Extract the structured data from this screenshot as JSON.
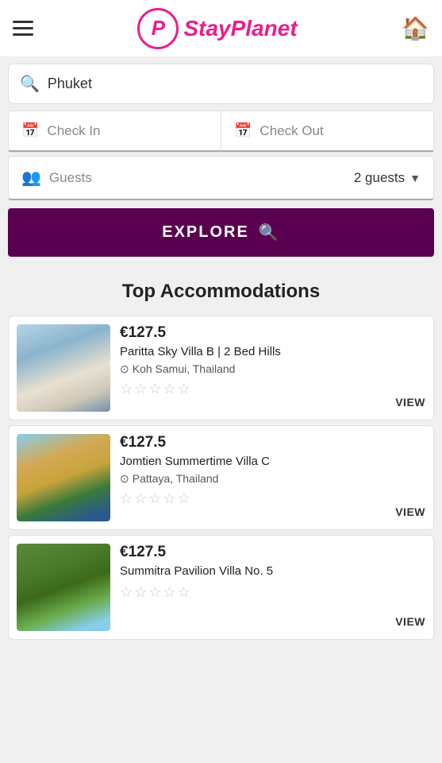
{
  "header": {
    "logo_letter": "P",
    "logo_name": "StayPlanet",
    "home_icon": "🏠"
  },
  "search": {
    "placeholder": "Phuket",
    "value": "Phuket"
  },
  "checkin": {
    "label": "Check In"
  },
  "checkout": {
    "label": "Check Out"
  },
  "guests": {
    "label": "Guests",
    "value": "2 guests"
  },
  "explore_button": {
    "label": "EXPLORE"
  },
  "section": {
    "title": "Top Accommodations"
  },
  "accommodations": [
    {
      "price": "€127.5",
      "name": "Paritta Sky Villa B | 2 Bed Hills",
      "location": "Koh Samui, Thailand",
      "view_label": "VIEW",
      "img_class": "img-room1"
    },
    {
      "price": "€127.5",
      "name": "Jomtien Summertime Villa C",
      "location": "Pattaya, Thailand",
      "view_label": "VIEW",
      "img_class": "img-room2"
    },
    {
      "price": "€127.5",
      "name": "Summitra Pavilion Villa No. 5",
      "location": "",
      "view_label": "VIEW",
      "img_class": "img-room3"
    }
  ]
}
